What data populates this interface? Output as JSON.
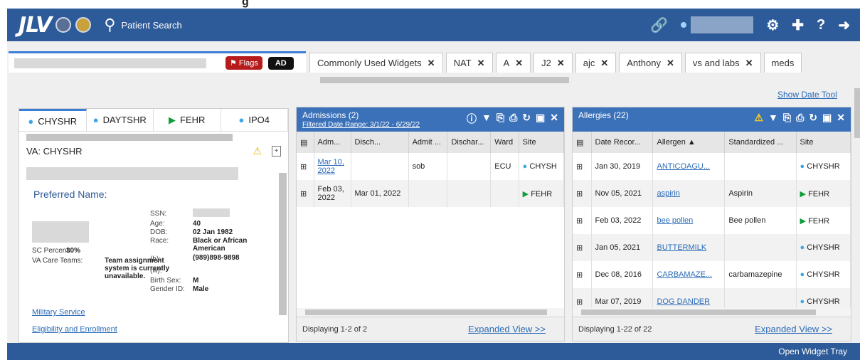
{
  "caption": "g",
  "header": {
    "logo": "JLV",
    "patient_search": "Patient Search",
    "icons": [
      "link-icon",
      "gear-icon",
      "add-note-icon",
      "help-icon",
      "logout-icon"
    ]
  },
  "patient": {
    "flags_label": "Flags",
    "ad_label": "AD"
  },
  "widget_tabs": [
    {
      "label": "Commonly Used Widgets"
    },
    {
      "label": "NAT"
    },
    {
      "label": "A"
    },
    {
      "label": "J2"
    },
    {
      "label": "ajc"
    },
    {
      "label": "Anthony"
    },
    {
      "label": "vs and labs"
    },
    {
      "label": "meds"
    }
  ],
  "show_date_tool": "Show Date Tool",
  "patient_panel": {
    "tabs": [
      "CHYSHR",
      "DAYTSHR",
      "FEHR",
      "IPO4"
    ],
    "va_label": "VA: CHYSHR",
    "preferred_name": "Preferred Name:",
    "sc_percent_label": "SC Percent:",
    "sc_percent_value": "30%",
    "va_care_teams_label": "VA Care Teams:",
    "va_care_teams_value": "Team assignment system is currently unavailable.",
    "fields": {
      "ssn_label": "SSN:",
      "age_label": "Age:",
      "age_value": "40",
      "dob_label": "DOB:",
      "dob_value": "02 Jan 1982",
      "race_label": "Race:",
      "race_value": "Black or African American",
      "h_label": "(h):",
      "h_value": "(989)898-9898",
      "w_label": "(w):",
      "birth_sex_label": "Birth Sex:",
      "birth_sex_value": "M",
      "gender_label": "Gender ID:",
      "gender_value": "Male"
    },
    "links": [
      "Military Service",
      "Eligibility and Enrollment"
    ]
  },
  "admissions": {
    "title": "Admissions (2)",
    "filter": "Filtered Date Range: 3/1/22 - 6/29/22",
    "columns": [
      "Adm...",
      "Disch...",
      "Admit ...",
      "Dischar...",
      "Ward",
      "Site"
    ],
    "rows": [
      {
        "adm": "Mar 10, 2022",
        "disch": "",
        "admit": "sob",
        "dischar": "",
        "ward": "ECU",
        "site": "CHYSH"
      },
      {
        "adm": "Feb 03, 2022",
        "disch": "Mar 01, 2022",
        "admit": "",
        "dischar": "",
        "ward": "",
        "site": "FEHR"
      }
    ],
    "footer": "Displaying 1-2 of 2",
    "expanded": "Expanded View >>"
  },
  "allergies": {
    "title": "Allergies (22)",
    "columns": [
      "Date Recor...",
      "Allergen",
      "Standardized ...",
      "Site"
    ],
    "rows": [
      {
        "date": "Jan 30, 2019",
        "allergen": "ANTICOAGU...",
        "std": "",
        "site": "CHYSHR"
      },
      {
        "date": "Nov 05, 2021",
        "allergen": "aspirin",
        "std": "Aspirin",
        "site": "FEHR"
      },
      {
        "date": "Feb 03, 2022",
        "allergen": "bee pollen",
        "std": "Bee pollen",
        "site": "FEHR"
      },
      {
        "date": "Jan 05, 2021",
        "allergen": "BUTTERMILK",
        "std": "",
        "site": "CHYSHR"
      },
      {
        "date": "Dec 08, 2016",
        "allergen": "CARBAMAZE...",
        "std": "carbamazepine",
        "site": "CHYSHR"
      },
      {
        "date": "Mar 07, 2019",
        "allergen": "DOG DANDER",
        "std": "",
        "site": "CHYSHR"
      }
    ],
    "footer": "Displaying 1-22 of 22",
    "expanded": "Expanded View >>"
  },
  "bottom": {
    "open_tray": "Open Widget Tray"
  }
}
